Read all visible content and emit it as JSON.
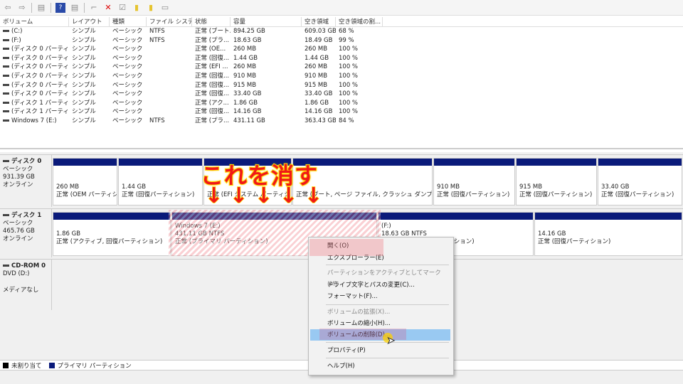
{
  "toolbar": {
    "icons": [
      "back-arrow-icon",
      "forward-arrow-icon",
      "console-tree-icon",
      "help-icon",
      "properties-panel-icon",
      "connect-icon",
      "delete-icon",
      "check-icon",
      "new-volume-icon",
      "search-volume-icon",
      "view-icon"
    ]
  },
  "table": {
    "columns": [
      "ボリューム",
      "レイアウト",
      "種類",
      "ファイル システム",
      "状態",
      "容量",
      "空き領域",
      "空き領域の割..."
    ],
    "rows": [
      [
        "(C:)",
        "シンプル",
        "ベーシック",
        "NTFS",
        "正常 (ブート...",
        "894.25 GB",
        "609.03 GB",
        "68 %"
      ],
      [
        "(F:)",
        "シンプル",
        "ベーシック",
        "NTFS",
        "正常 (プラ...",
        "18.63 GB",
        "18.49 GB",
        "99 %"
      ],
      [
        "(ディスク 0 パーティシ...",
        "シンプル",
        "ベーシック",
        "",
        "正常 (OE...",
        "260 MB",
        "260 MB",
        "100 %"
      ],
      [
        "(ディスク 0 パーティシ...",
        "シンプル",
        "ベーシック",
        "",
        "正常 (回復...",
        "1.44 GB",
        "1.44 GB",
        "100 %"
      ],
      [
        "(ディスク 0 パーティシ...",
        "シンプル",
        "ベーシック",
        "",
        "正常 (EFI ...",
        "260 MB",
        "260 MB",
        "100 %"
      ],
      [
        "(ディスク 0 パーティシ...",
        "シンプル",
        "ベーシック",
        "",
        "正常 (回復...",
        "910 MB",
        "910 MB",
        "100 %"
      ],
      [
        "(ディスク 0 パーティシ...",
        "シンプル",
        "ベーシック",
        "",
        "正常 (回復...",
        "915 MB",
        "915 MB",
        "100 %"
      ],
      [
        "(ディスク 0 パーティシ...",
        "シンプル",
        "ベーシック",
        "",
        "正常 (回復...",
        "33.40 GB",
        "33.40 GB",
        "100 %"
      ],
      [
        "(ディスク 1 パーティシ...",
        "シンプル",
        "ベーシック",
        "",
        "正常 (アク...",
        "1.86 GB",
        "1.86 GB",
        "100 %"
      ],
      [
        "(ディスク 1 パーティシ...",
        "シンプル",
        "ベーシック",
        "",
        "正常 (回復...",
        "14.16 GB",
        "14.16 GB",
        "100 %"
      ],
      [
        "Windows 7 (E:)",
        "シンプル",
        "ベーシック",
        "NTFS",
        "正常 (プラ...",
        "431.11 GB",
        "363.43 GB",
        "84 %"
      ]
    ]
  },
  "disks": [
    {
      "name": "ディスク 0",
      "type": "ベーシック",
      "size": "931.39 GB",
      "status": "オンライン",
      "partitions": [
        {
          "l1": "",
          "l2": "260 MB",
          "l3": "正常 (OEM パーティション)"
        },
        {
          "l1": "",
          "l2": "1.44 GB",
          "l3": "正常 (回復パーティション)"
        },
        {
          "l1": "",
          "l2": "",
          "l3": "正常 (EFI システム パーティション)"
        },
        {
          "l1": "",
          "l2": "",
          "l3": "正常 (ブート, ページ ファイル, クラッシュ ダンプ, ベーシック データ パーティション)"
        },
        {
          "l1": "",
          "l2": "910 MB",
          "l3": "正常 (回復パーティション)"
        },
        {
          "l1": "",
          "l2": "915 MB",
          "l3": "正常 (回復パーティション)"
        },
        {
          "l1": "",
          "l2": "33.40 GB",
          "l3": "正常 (回復パーティション)"
        }
      ]
    },
    {
      "name": "ディスク 1",
      "type": "ベーシック",
      "size": "465.76 GB",
      "status": "オンライン",
      "partitions": [
        {
          "l1": "",
          "l2": "1.86 GB",
          "l3": "正常 (アクティブ, 回復パーティション)"
        },
        {
          "l1": "Windows 7  (E:)",
          "l2": "431.11 GB NTFS",
          "l3": "正常 (プライマリ パーティション)"
        },
        {
          "l1": "(F:)",
          "l2": "18.63 GB NTFS",
          "l3": "正常 (プライマリ パーティション)"
        },
        {
          "l1": "",
          "l2": "14.16 GB",
          "l3": "正常 (回復パーティション)"
        }
      ]
    },
    {
      "name": "CD-ROM 0",
      "type": "DVD (D:)",
      "size": "",
      "status": "メディアなし",
      "partitions": []
    }
  ],
  "legend": [
    {
      "label": "未割り当て",
      "color": "#000000"
    },
    {
      "label": "プライマリ パーティション",
      "color": "#0a1a7a"
    }
  ],
  "context_menu": [
    {
      "label": "開く(O)",
      "disabled": false
    },
    {
      "label": "エクスプローラー(E)",
      "disabled": false
    },
    {
      "label": "パーティションをアクティブとしてマーク(M)",
      "disabled": true
    },
    {
      "label": "ドライブ文字とパスの変更(C)...",
      "disabled": false
    },
    {
      "label": "フォーマット(F)...",
      "disabled": false
    },
    {
      "label": "ボリュームの拡張(X)...",
      "disabled": true
    },
    {
      "label": "ボリュームの縮小(H)...",
      "disabled": false
    },
    {
      "label": "ボリュームの削除(D)...",
      "disabled": false,
      "highlighted": true
    },
    {
      "label": "プロパティ(P)",
      "disabled": false
    },
    {
      "label": "ヘルプ(H)",
      "disabled": false
    }
  ],
  "annotation": {
    "text": "これを消す",
    "arrow": "↓"
  },
  "colors": {
    "partition_bar": "#0a1a7a",
    "menu_highlight": "#99c9f2",
    "annotation_text": "#f01818",
    "annotation_outline": "#ffe000"
  }
}
